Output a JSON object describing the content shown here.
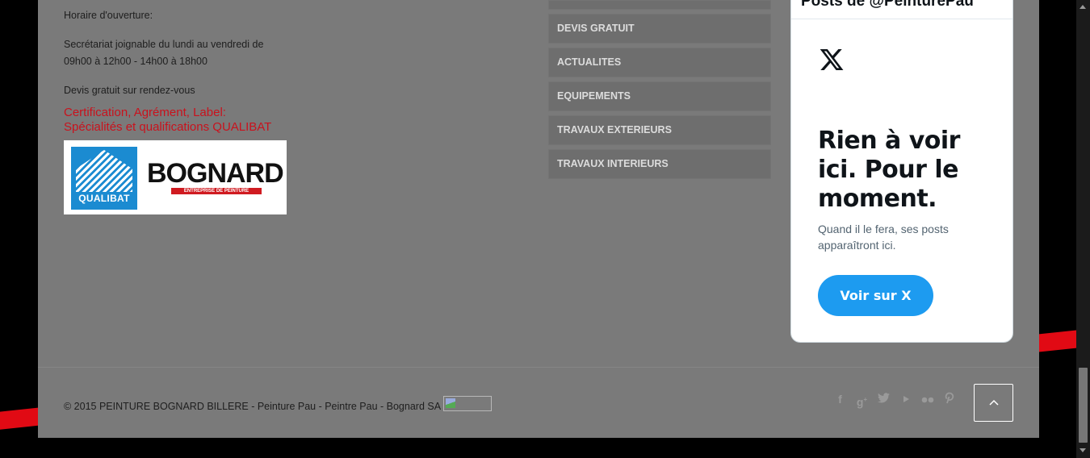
{
  "hours": {
    "title": "Horaire d'ouverture:",
    "line1": "Secrétariat joignable du lundi au vendredi de",
    "line2": "09h00 à 12h00 - 14h00 à 18h00",
    "quote": "Devis gratuit sur rendez-vous"
  },
  "certification": {
    "line1": "Certification, Agrément, Label:",
    "line2": "Spécialités et qualifications QUALIBAT",
    "qualibat_label": "QUALIBAT",
    "brand": "BOGNARD",
    "brand_sub": "ENTREPRISE DE PEINTURE"
  },
  "menu": {
    "items": [
      {
        "label": ""
      },
      {
        "label": "DEVIS GRATUIT"
      },
      {
        "label": "ACTUALITES"
      },
      {
        "label": "EQUIPEMENTS"
      },
      {
        "label": "TRAVAUX EXTERIEURS"
      },
      {
        "label": "TRAVAUX INTERIEURS"
      }
    ]
  },
  "twitter": {
    "header": "Posts de @PeinturePau",
    "heading": "Rien à voir ici. Pour le moment.",
    "subtext": "Quand il le fera, ses posts apparaîtront ici.",
    "button": "Voir sur X"
  },
  "footer": {
    "copyright": "© 2015 PEINTURE BOGNARD BILLERE - Peinture Pau - Peintre Pau - Bognard SA",
    "socials": [
      "facebook-icon",
      "google-plus-icon",
      "twitter-icon",
      "youtube-icon",
      "flickr-icon",
      "pinterest-icon"
    ]
  },
  "colors": {
    "page_bg": "#7a7a7a",
    "accent_red": "#c9121d",
    "twitter_blue": "#1d9bf0"
  }
}
